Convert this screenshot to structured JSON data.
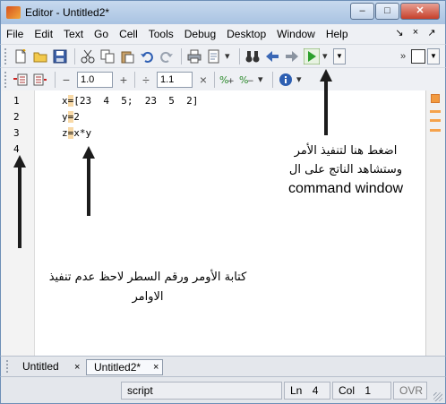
{
  "window": {
    "title": "Editor - Untitled2*",
    "minimize": "–",
    "maximize": "□",
    "close": "✕"
  },
  "menu": {
    "items": [
      "File",
      "Edit",
      "Text",
      "Go",
      "Cell",
      "Tools",
      "Debug",
      "Desktop",
      "Window",
      "Help"
    ],
    "right_icons": [
      "↘",
      "×",
      "↗"
    ]
  },
  "toolbar2": {
    "minus": "−",
    "value1": "1.0",
    "plus": "+",
    "divide": "÷",
    "value2": "1.1",
    "times": "×"
  },
  "editor": {
    "line_numbers": [
      "1",
      "2",
      "3",
      "4"
    ],
    "lines": [
      {
        "pre": "x",
        "mid": "=",
        "post": "[23  4  5;  23  5  2]"
      },
      {
        "pre": "y",
        "mid": "=",
        "post": "2"
      },
      {
        "pre": "z",
        "mid": "=",
        "post": "x*y"
      }
    ]
  },
  "annotations": {
    "run_note_line1": "اضغط هنا لتنفيذ الأمر",
    "run_note_line2": "وستشاهد الناتج على ال",
    "run_note_line3": "command window",
    "lines_note_line1": "كتابة الأومر ورقم السطر لاحظ عدم تنفيذ",
    "lines_note_line2": "الاوامر"
  },
  "tabs": [
    {
      "label": "Untitled",
      "close": "×"
    },
    {
      "label": "Untitled2*",
      "close": "×"
    }
  ],
  "status": {
    "mode": "script",
    "ln_label": "Ln",
    "ln_value": "4",
    "col_label": "Col",
    "col_value": "1",
    "ovr": "OVR"
  },
  "colors": {
    "run_green": "#2ca02c",
    "highlight": "#f8d9a7",
    "title_bar": "#b9cfe8"
  }
}
